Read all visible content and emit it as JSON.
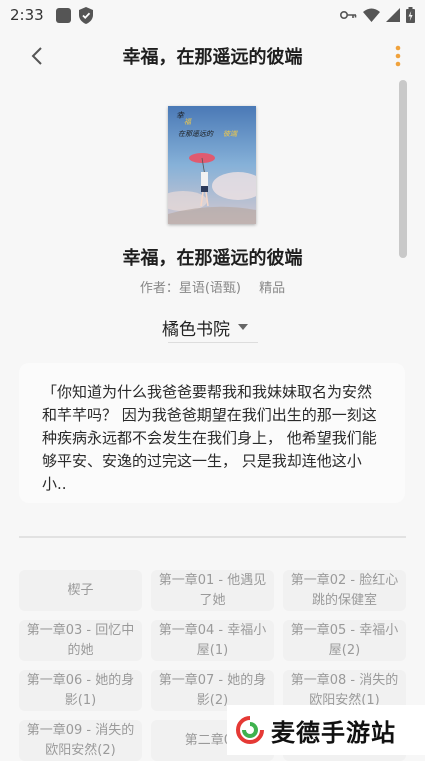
{
  "status_bar": {
    "time": "2:33"
  },
  "toolbar": {
    "title": "幸福，在那遥远的彼端"
  },
  "book": {
    "cover_title": "幸福，在那遥远的彼端",
    "title": "幸福，在那遥远的彼端",
    "author_label": "作者：",
    "author": "星语(语甄)",
    "tag": "精品",
    "source": "橘色书院",
    "description": "「你知道为什么我爸爸要帮我和我妹妹取名为安然和芊芊吗？ 因为我爸爸期望在我们出生的那一刻这种疾病永远都不会发生在我们身上， 他希望我们能够平安、安逸的过完这一生， 只是我却连他这小小.."
  },
  "chapters": [
    "楔子",
    "第一章01 - 他遇见了她",
    "第一章02 - 脸红心跳的保健室",
    "第一章03 - 回忆中的她",
    "第一章04 - 幸福小屋(1)",
    "第一章05 - 幸福小屋(2)",
    "第一章06 - 她的身影(1)",
    "第一章07 - 她的身影(2)",
    "第一章08 - 消失的欧阳安然(1)",
    "第一章09 - 消失的欧阳安然(2)",
    "第二章01",
    ""
  ],
  "watermark": {
    "text": "麦德手游站"
  },
  "colors": {
    "accent": "#f0a23c",
    "background": "#f7f7f7",
    "card": "#fbfbfb",
    "chip": "#f1f1f1",
    "watermark_red": "#e53935",
    "watermark_green": "#3fb24e"
  },
  "icons": {
    "status": [
      "media-icon",
      "shield-icon",
      "key-icon",
      "wifi-icon",
      "signal-icon",
      "battery-icon"
    ],
    "toolbar": [
      "back-arrow-icon",
      "more-vert-icon"
    ]
  }
}
